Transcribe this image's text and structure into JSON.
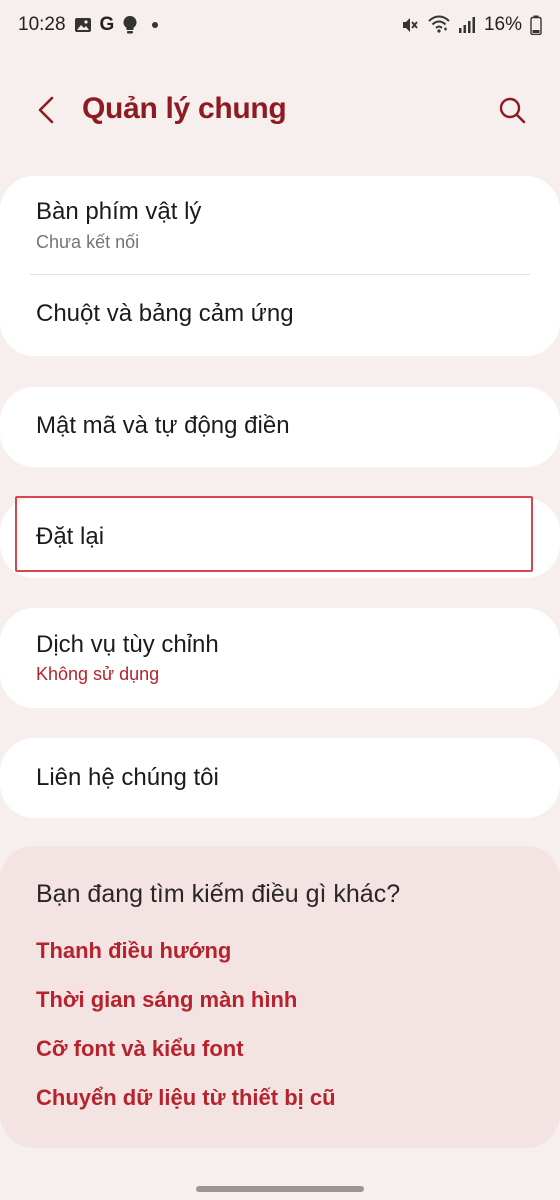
{
  "status": {
    "time": "10:28",
    "g_label": "G",
    "battery": "16%"
  },
  "header": {
    "title": "Quản lý chung"
  },
  "group1": {
    "keyboard_title": "Bàn phím vật lý",
    "keyboard_sub": "Chưa kết nối",
    "mouse_title": "Chuột và bảng cảm ứng"
  },
  "group2": {
    "password_title": "Mật mã và tự động điền"
  },
  "group3": {
    "reset_title": "Đặt lại"
  },
  "group4": {
    "custom_title": "Dịch vụ tùy chỉnh",
    "custom_sub": "Không sử dụng"
  },
  "group5": {
    "contact_title": "Liên hệ chúng tôi"
  },
  "suggestions": {
    "heading": "Bạn đang tìm kiếm điều gì khác?",
    "links": [
      "Thanh điều hướng",
      "Thời gian sáng màn hình",
      "Cỡ font và kiểu font",
      "Chuyển dữ liệu từ thiết bị cũ"
    ]
  },
  "colors": {
    "accent": "#8e1b22",
    "link": "#b5242c",
    "background": "#f7eeee",
    "card": "#ffffff",
    "highlight": "#d94652"
  }
}
